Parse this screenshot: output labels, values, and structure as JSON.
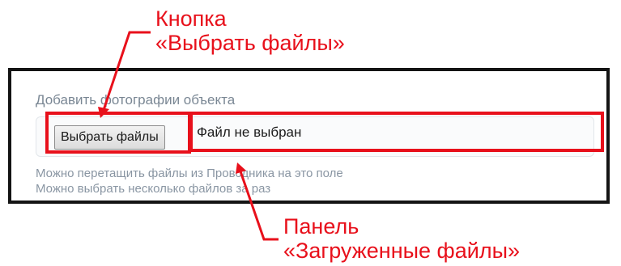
{
  "annotations": {
    "button_caption_line1": "Кнопка",
    "button_caption_line2": "«Выбрать файлы»",
    "panel_caption_line1": "Панель",
    "panel_caption_line2": "«Загруженные файлы»"
  },
  "form": {
    "label": "Добавить фотографии объекта",
    "choose_button_label": "Выбрать файлы",
    "file_status": "Файл не выбран",
    "hint_drag": "Можно перетащить файлы из Проводника на это поле",
    "hint_multiple": "Можно выбрать несколько файлов за раз"
  },
  "colors": {
    "annotation_red": "#e8101b",
    "frame_border": "#141414",
    "label_gray": "#7a8794",
    "hint_gray": "#8a96a3"
  }
}
